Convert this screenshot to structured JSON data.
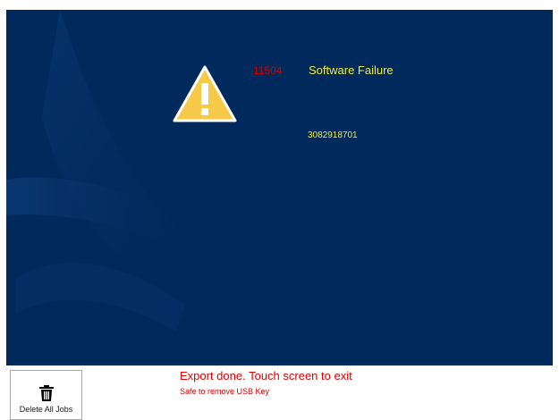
{
  "error": {
    "code": "11504",
    "title": "Software Failure",
    "serial": "3082918701",
    "icon": "warning-triangle-icon"
  },
  "footer": {
    "delete_button_label": "Delete All Jobs",
    "delete_icon": "trash-icon",
    "export_message": "Export done. Touch screen to exit",
    "usb_message": "Safe to remove USB Key"
  },
  "colors": {
    "screen_background": "#012a5c",
    "error_code": "#d40000",
    "error_text": "#f2ea3a",
    "status_message": "#e00000"
  }
}
